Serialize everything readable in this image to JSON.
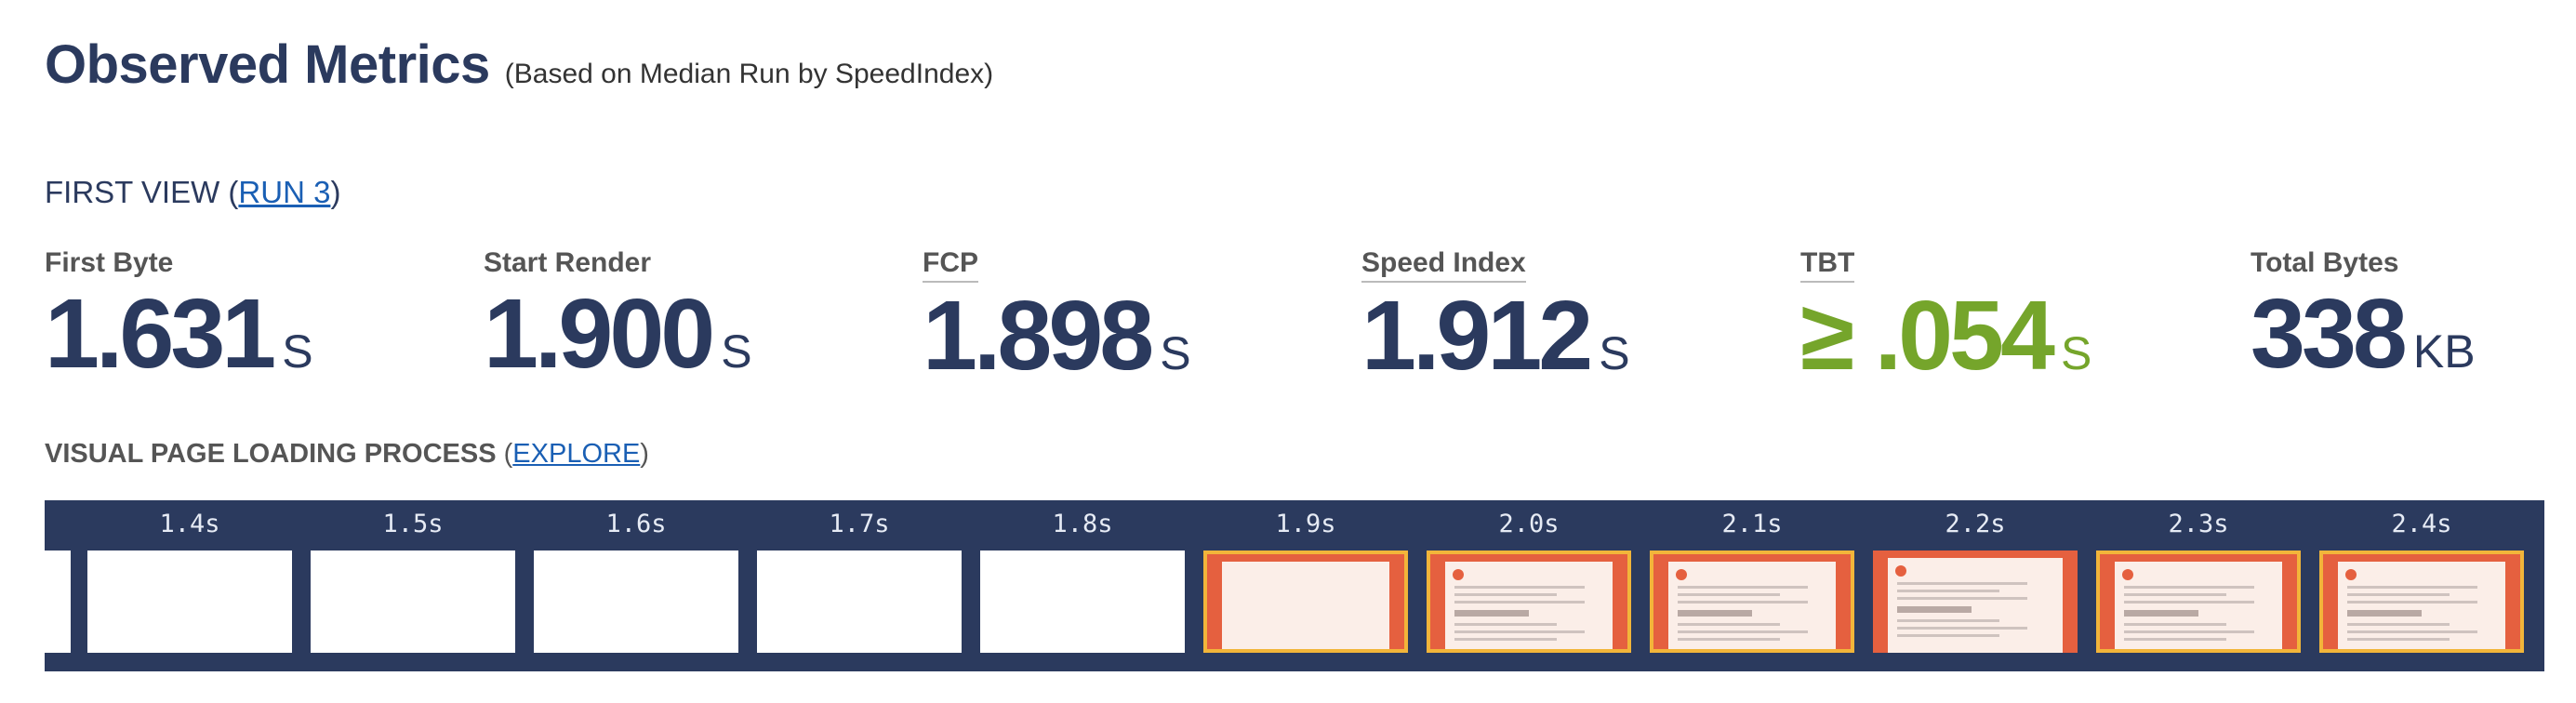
{
  "header": {
    "title": "Observed Metrics",
    "subtitle": "(Based on Median Run by SpeedIndex)"
  },
  "first_view": {
    "prefix": "FIRST VIEW (",
    "run_link": "RUN 3",
    "suffix": ")"
  },
  "metrics": [
    {
      "label": "First Byte",
      "value": "1.631",
      "unit": "S"
    },
    {
      "label": "Start Render",
      "value": "1.900",
      "unit": "S"
    },
    {
      "label": "FCP",
      "value": "1.898",
      "unit": "S"
    },
    {
      "label": "Speed Index",
      "value": "1.912",
      "unit": "S"
    },
    {
      "label": "TBT",
      "value": "≥ .054",
      "unit": "S"
    },
    {
      "label": "Total Bytes",
      "value": "338",
      "unit": "KB"
    }
  ],
  "visual": {
    "label": "VISUAL PAGE LOADING PROCESS",
    "open_paren": "(",
    "explore_link": "EXPLORE",
    "close_paren": ")"
  },
  "filmstrip": {
    "frames": [
      {
        "time": "1.4s",
        "changed": false
      },
      {
        "time": "1.5s",
        "changed": false
      },
      {
        "time": "1.6s",
        "changed": false
      },
      {
        "time": "1.7s",
        "changed": false
      },
      {
        "time": "1.8s",
        "changed": false
      },
      {
        "time": "1.9s",
        "changed": true,
        "content": false
      },
      {
        "time": "2.0s",
        "changed": true,
        "content": true
      },
      {
        "time": "2.1s",
        "changed": true,
        "content": true
      },
      {
        "time": "2.2s",
        "changed": false,
        "content": true
      },
      {
        "time": "2.3s",
        "changed": true,
        "content": true
      },
      {
        "time": "2.4s",
        "changed": true,
        "content": true
      }
    ]
  },
  "colors": {
    "brand_navy": "#2b3a5e",
    "good_green": "#75a52b",
    "link_blue": "#1a5fb4",
    "frame_changed_border": "#f2b53a",
    "page_orange": "#e5603f"
  }
}
